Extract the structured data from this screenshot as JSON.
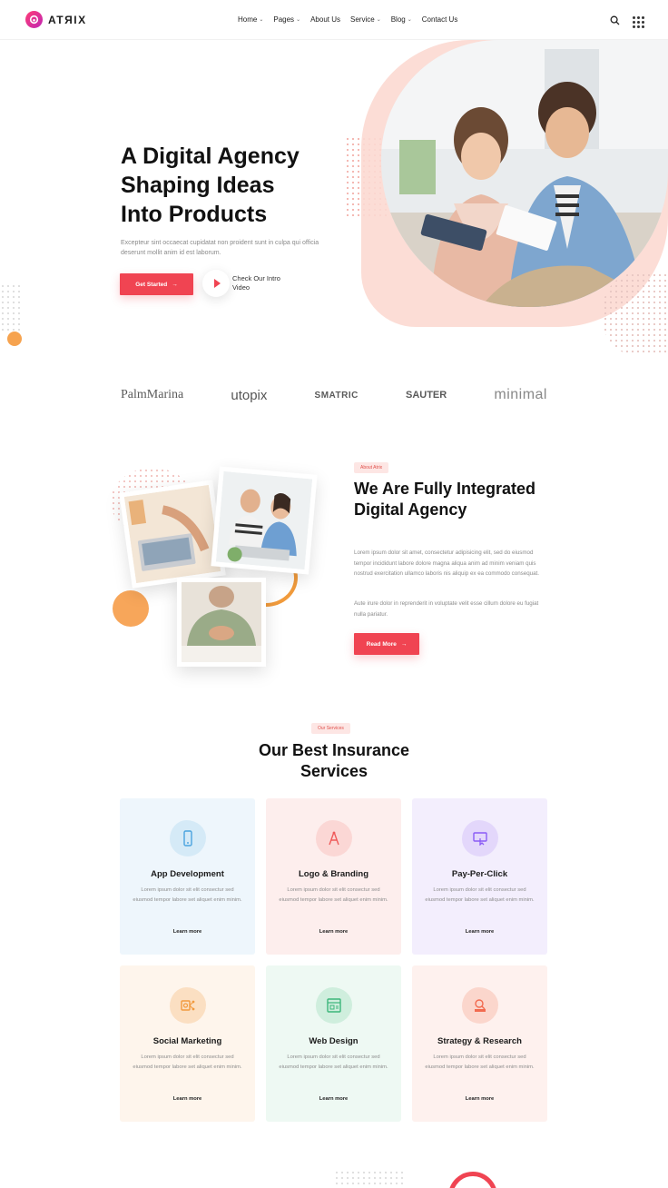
{
  "brand": {
    "name": "ATЯIX"
  },
  "nav": {
    "items": [
      {
        "label": "Home",
        "has_dropdown": true
      },
      {
        "label": "Pages",
        "has_dropdown": true
      },
      {
        "label": "About Us",
        "has_dropdown": false
      },
      {
        "label": "Service",
        "has_dropdown": true
      },
      {
        "label": "Blog",
        "has_dropdown": true
      },
      {
        "label": "Contact Us",
        "has_dropdown": false
      }
    ],
    "icons": [
      "search-icon",
      "grid-menu-icon"
    ]
  },
  "hero": {
    "title_line1": "A Digital Agency",
    "title_line2": "Shaping Ideas",
    "title_line3": "Into Products",
    "text": "Excepteur sint occaecat cupidatat non proident sunt in culpa qui officia deserunt mollit anim id est laborum.",
    "cta_label": "Get Started",
    "video_label": "Check Our Intro Video"
  },
  "clients": [
    {
      "name": "PalmMarina"
    },
    {
      "name": "utopix"
    },
    {
      "name": "SMATRIC"
    },
    {
      "name": "SAUTER"
    },
    {
      "name": "minimal"
    }
  ],
  "about": {
    "tag": "About Atrix",
    "title": "We Are Fully Integrated Digital Agency",
    "paragraph1": "Lorem ipsum dolor sit amet, consectetur adipisicing elit, sed do eiusmod tempor incididunt labore dolore magna aliqua anim ad minim veniam quis nostrud exercitation ullamco laboris nis aliquip ex ea commodo consequat.",
    "paragraph2": "Aute irure dolor in reprenderit in voluptate velit esse cillum dolore eu fugiat nulla pariatur.",
    "cta_label": "Read More"
  },
  "services": {
    "tag": "Our Services",
    "title_line1": "Our Best Insurance",
    "title_line2": "Services",
    "cards": [
      {
        "title": "App Development",
        "text": "Lorem ipsum dolor sit elit consectur sed eiusmod tempor labore set aliquet enim minim.",
        "link": "Learn more",
        "icon": "mobile-icon",
        "accent": "#4aa3df"
      },
      {
        "title": "Logo & Branding",
        "text": "Lorem ipsum dolor sit elit consectur sed eiusmod tempor labore set aliquet enim minim.",
        "link": "Learn more",
        "icon": "pen-tool-icon",
        "accent": "#ef5a5a"
      },
      {
        "title": "Pay-Per-Click",
        "text": "Lorem ipsum dolor sit elit consectur sed eiusmod tempor labore set aliquet enim minim.",
        "link": "Learn more",
        "icon": "click-monitor-icon",
        "accent": "#8b5cf6"
      },
      {
        "title": "Social Marketing",
        "text": "Lorem ipsum dolor sit elit consectur sed eiusmod tempor labore set aliquet enim minim.",
        "link": "Learn more",
        "icon": "share-icon",
        "accent": "#f29a3e"
      },
      {
        "title": "Web Design",
        "text": "Lorem ipsum dolor sit elit consectur sed eiusmod tempor labore set aliquet enim minim.",
        "link": "Learn more",
        "icon": "layout-icon",
        "accent": "#3cb67a"
      },
      {
        "title": "Strategy & Research",
        "text": "Lorem ipsum dolor sit elit consectur sed eiusmod tempor labore set aliquet enim minim.",
        "link": "Learn more",
        "icon": "research-icon",
        "accent": "#f26a4f"
      }
    ]
  },
  "colors": {
    "primary": "#f04452",
    "accent_orange": "#f6a34f",
    "hero_blob": "#fcd9d2"
  }
}
